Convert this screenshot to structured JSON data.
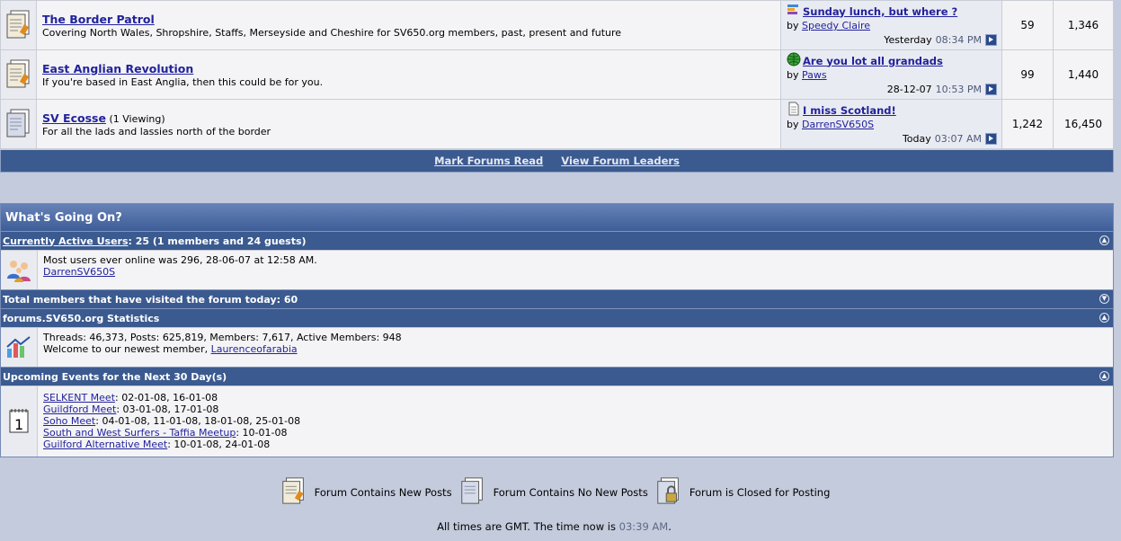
{
  "forums": [
    {
      "title": "The Border Patrol",
      "viewing": "",
      "description": "Covering North Wales, Shropshire, Staffs, Merseyside and Cheshire for SV650.org members, past, present and future",
      "icon": "forum-new-posts-icon",
      "last_post": {
        "title": "Sunday lunch, but where ?",
        "by_label": "by",
        "author": "Speedy Claire",
        "date": "Yesterday",
        "time": "08:34 PM",
        "post_icon": "bar-chart-icon"
      },
      "threads": "59",
      "posts": "1,346"
    },
    {
      "title": "East Anglian Revolution",
      "viewing": "",
      "description": "If you're based in East Anglia, then this could be for you.",
      "icon": "forum-new-posts-icon",
      "last_post": {
        "title": "Are you lot all grandads",
        "by_label": "by",
        "author": "Paws",
        "date": "28-12-07",
        "time": "10:53 PM",
        "post_icon": "globe-icon"
      },
      "threads": "99",
      "posts": "1,440"
    },
    {
      "title": "SV Ecosse",
      "viewing": "(1 Viewing)",
      "description": "For all the lads and lassies north of the border",
      "icon": "forum-no-new-posts-icon",
      "last_post": {
        "title": "I miss Scotland!",
        "by_label": "by",
        "author": "DarrenSV650S",
        "date": "Today",
        "time": "03:07 AM",
        "post_icon": "document-icon"
      },
      "threads": "1,242",
      "posts": "16,450"
    }
  ],
  "bottom_links": {
    "mark_read": "Mark Forums Read",
    "leaders": "View Forum Leaders"
  },
  "wgo": {
    "title": "What's Going On?",
    "active_users": {
      "link": "Currently Active Users",
      "rest": ": 25 (1 members and 24 guests)",
      "record": "Most users ever online was 296, 28-06-07 at 12:58 AM.",
      "user": "DarrenSV650S"
    },
    "visited_today": "Total members that have visited the forum today: 60",
    "stats": {
      "title": "forums.SV650.org Statistics",
      "line": "Threads: 46,373, Posts: 625,819, Members: 7,617, Active Members: 948",
      "welcome": "Welcome to our newest member, ",
      "newest": "Laurenceofarabia"
    },
    "events": {
      "title": "Upcoming Events for the Next 30 Day(s)",
      "items": [
        {
          "name": "SELKENT Meet",
          "dates": ": 02-01-08, 16-01-08"
        },
        {
          "name": "Guildford Meet",
          "dates": ": 03-01-08, 17-01-08"
        },
        {
          "name": "Soho Meet",
          "dates": ": 04-01-08, 11-01-08, 18-01-08, 25-01-08"
        },
        {
          "name": "South and West Surfers - Taffia Meetup",
          "dates": ": 10-01-08"
        },
        {
          "name": "Guilford Alternative Meet",
          "dates": ": 10-01-08, 24-01-08"
        }
      ]
    }
  },
  "legend": {
    "new_posts": "Forum Contains New Posts",
    "no_new_posts": "Forum Contains No New Posts",
    "closed": "Forum is Closed for Posting"
  },
  "footer": {
    "prefix": "All times are GMT. The time now is ",
    "time": "03:39 AM",
    "suffix": "."
  },
  "colors": {
    "link": "#22229c",
    "header_bar": "#3b5a8f",
    "page_bg": "#c4cbdc"
  }
}
